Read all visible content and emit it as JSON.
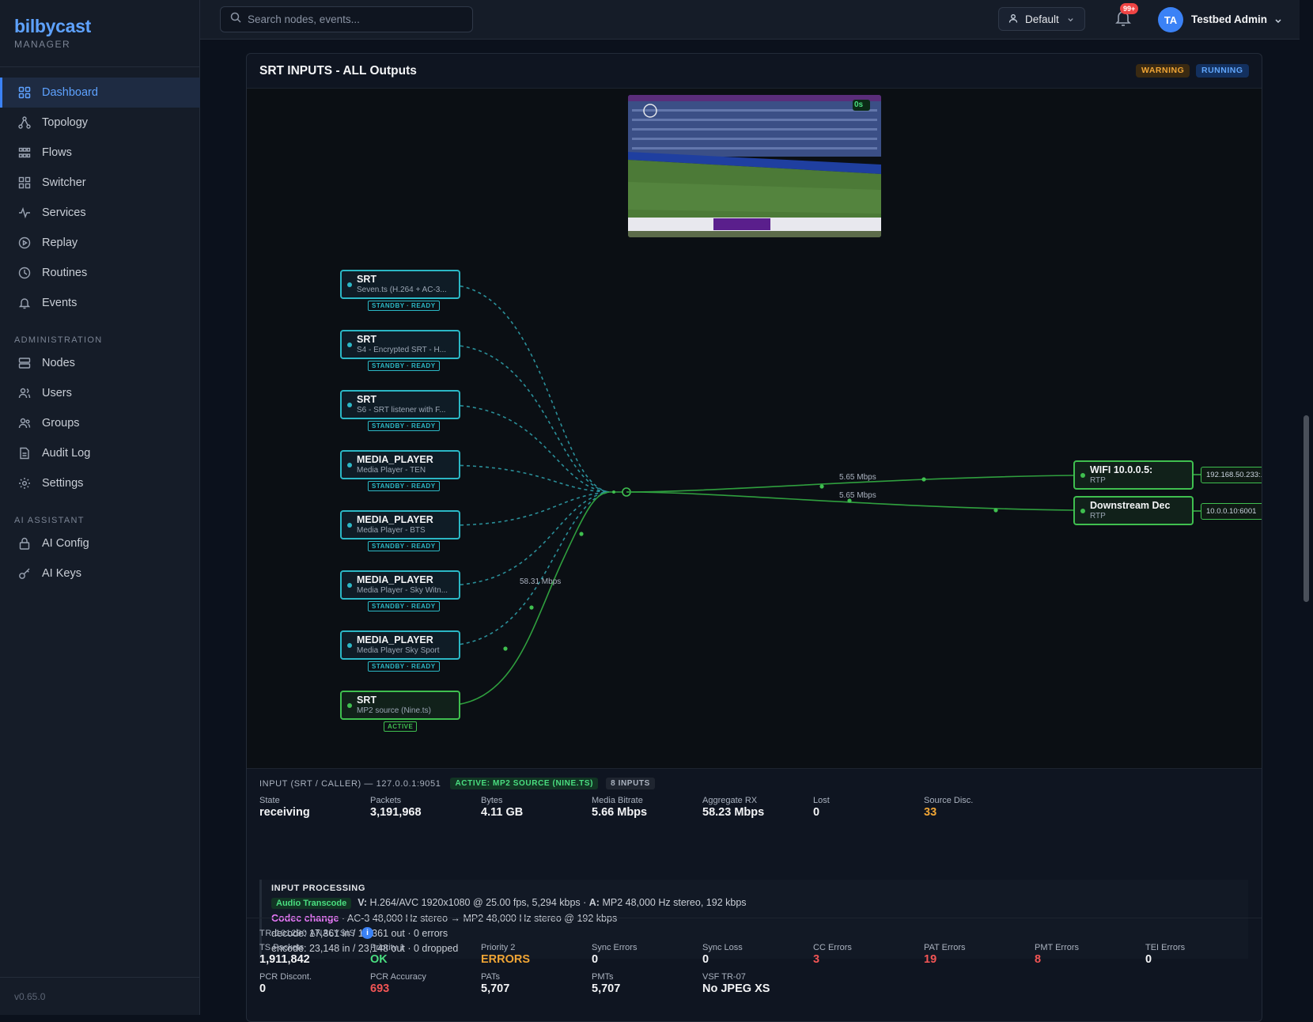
{
  "brand": {
    "name": "bilbycast",
    "subtitle": "MANAGER"
  },
  "nav": {
    "main": [
      {
        "label": "Dashboard",
        "icon": "grid-icon",
        "active": true
      },
      {
        "label": "Topology",
        "icon": "topology-icon"
      },
      {
        "label": "Flows",
        "icon": "flows-icon"
      },
      {
        "label": "Switcher",
        "icon": "switcher-icon"
      },
      {
        "label": "Services",
        "icon": "activity-icon"
      },
      {
        "label": "Replay",
        "icon": "play-circle-icon"
      },
      {
        "label": "Routines",
        "icon": "clock-icon"
      },
      {
        "label": "Events",
        "icon": "bell-icon"
      }
    ],
    "admin_label": "ADMINISTRATION",
    "admin": [
      {
        "label": "Nodes",
        "icon": "server-icon"
      },
      {
        "label": "Users",
        "icon": "users-icon"
      },
      {
        "label": "Groups",
        "icon": "group-icon"
      },
      {
        "label": "Audit Log",
        "icon": "file-icon"
      },
      {
        "label": "Settings",
        "icon": "gear-icon"
      }
    ],
    "ai_label": "AI ASSISTANT",
    "ai": [
      {
        "label": "AI Config",
        "icon": "lock-icon"
      },
      {
        "label": "AI Keys",
        "icon": "key-icon"
      }
    ]
  },
  "version": "v0.65.0",
  "topbar": {
    "search_placeholder": "Search nodes, events...",
    "workspace": "Default",
    "notifications": "99+",
    "avatar_initials": "TA",
    "user_name": "Testbed Admin"
  },
  "panel": {
    "title": "SRT INPUTS - ALL Outputs",
    "status_warning": "WARNING",
    "status_running": "RUNNING",
    "preview_timer": "0s"
  },
  "inputs": [
    {
      "type": "SRT",
      "name": "Seven.ts (H.264 + AC-3...",
      "status": "STANDBY · READY"
    },
    {
      "type": "SRT",
      "name": "S4 - Encrypted SRT - H...",
      "status": "STANDBY · READY"
    },
    {
      "type": "SRT",
      "name": "S6 - SRT listener with F...",
      "status": "STANDBY · READY"
    },
    {
      "type": "MEDIA_PLAYER",
      "name": "Media Player - TEN",
      "status": "STANDBY · READY"
    },
    {
      "type": "MEDIA_PLAYER",
      "name": "Media Player - BTS",
      "status": "STANDBY · READY"
    },
    {
      "type": "MEDIA_PLAYER",
      "name": "Media Player - Sky Witn...",
      "status": "STANDBY · READY"
    },
    {
      "type": "MEDIA_PLAYER",
      "name": "Media Player Sky Sport",
      "status": "STANDBY · READY"
    },
    {
      "type": "SRT",
      "name": "MP2 source (Nine.ts)",
      "status": "ACTIVE"
    }
  ],
  "outputs": [
    {
      "name": "WIFI 10.0.0.5:",
      "proto": "RTP",
      "addr": "192.168.50.233:...",
      "rate": "5.65 Mbps"
    },
    {
      "name": "Downstream Dec",
      "proto": "RTP",
      "addr": "10.0.0.10:6001",
      "rate": "5.65 Mbps"
    }
  ],
  "input_rate": "58.31 Mbps",
  "input_info": {
    "header": "INPUT (SRT / CALLER) — 127.0.0.1:9051",
    "active_pill": "ACTIVE: MP2 SOURCE (NINE.TS)",
    "count_pill": "8 INPUTS",
    "stats": [
      {
        "label": "State",
        "value": "receiving"
      },
      {
        "label": "Packets",
        "value": "3,191,968"
      },
      {
        "label": "Bytes",
        "value": "4.11 GB"
      },
      {
        "label": "Media Bitrate",
        "value": "5.66 Mbps"
      },
      {
        "label": "Aggregate RX",
        "value": "58.23 Mbps"
      },
      {
        "label": "Lost",
        "value": "0"
      },
      {
        "label": "Source Disc.",
        "value": "33"
      }
    ]
  },
  "processing": {
    "title": "INPUT PROCESSING",
    "tag": "Audio Transcode",
    "video_label": "V:",
    "video": "H.264/AVC 1920x1080 @ 25.00 fps, 5,294 kbps ·",
    "audio_label": "A:",
    "audio": "MP2 48,000 Hz stereo, 192 kbps",
    "codec_change_label": "Codec change",
    "codec_change": "· AC-3 48,000 Hz stereo → MP2 48,000 Hz stereo @ 192 kbps",
    "decode": "decode: 17,361 in / 17,361 out · 0 errors",
    "encode": "encode: 23,148 in / 23,148 out · 0 dropped"
  },
  "tr101290": {
    "title": "TR-101290 ANALYSIS",
    "row1": [
      {
        "label": "TS Packets",
        "value": "1,911,842",
        "tone": ""
      },
      {
        "label": "Priority 1",
        "value": "OK",
        "tone": "green"
      },
      {
        "label": "Priority 2",
        "value": "ERRORS",
        "tone": "amber"
      },
      {
        "label": "Sync Errors",
        "value": "0",
        "tone": ""
      },
      {
        "label": "Sync Loss",
        "value": "0",
        "tone": ""
      },
      {
        "label": "CC Errors",
        "value": "3",
        "tone": "red"
      },
      {
        "label": "PAT Errors",
        "value": "19",
        "tone": "red"
      },
      {
        "label": "PMT Errors",
        "value": "8",
        "tone": "red"
      },
      {
        "label": "TEI Errors",
        "value": "0",
        "tone": ""
      }
    ],
    "row2": [
      {
        "label": "PCR Discont.",
        "value": "0",
        "tone": ""
      },
      {
        "label": "PCR Accuracy",
        "value": "693",
        "tone": "red"
      },
      {
        "label": "PATs",
        "value": "5,707",
        "tone": ""
      },
      {
        "label": "PMTs",
        "value": "5,707",
        "tone": ""
      },
      {
        "label": "VSF TR-07",
        "value": "No JPEG XS",
        "tone": ""
      }
    ]
  },
  "colors": {
    "accent": "#3b82f6",
    "standby": "#2bb7c5",
    "active": "#3fbf4f",
    "warning": "#f0a535",
    "error": "#f25555"
  }
}
